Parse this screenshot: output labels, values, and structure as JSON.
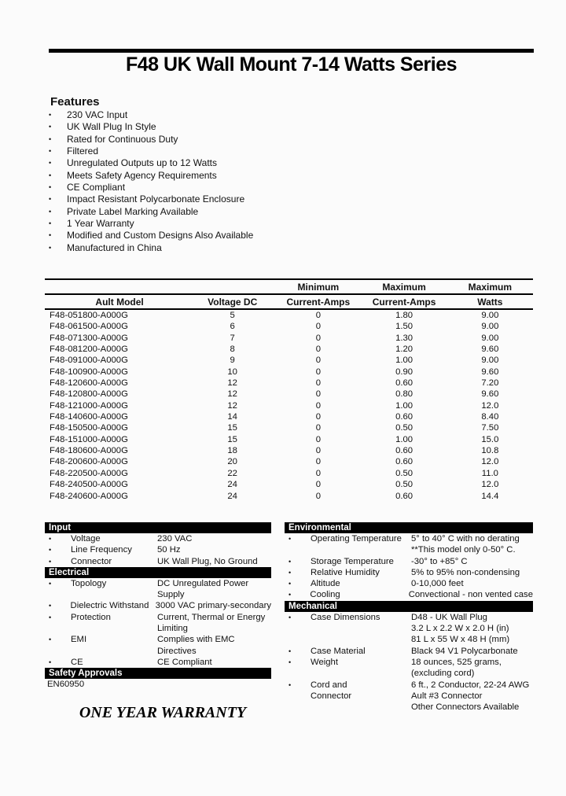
{
  "title": "F48 UK Wall Mount 7-14 Watts Series",
  "features": {
    "heading": "Features",
    "bullet": "•",
    "items": [
      "230 VAC Input",
      "UK Wall Plug In Style",
      "Rated for Continuous Duty",
      "Filtered",
      "Unregulated Outputs up to 12 Watts",
      "Meets Safety Agency Requirements",
      "CE Compliant",
      "Impact Resistant Polycarbonate Enclosure",
      "Private Label Marking Available",
      "1 Year Warranty",
      "Modified and Custom Designs Also Available",
      "Manufactured in China"
    ]
  },
  "models_table": {
    "headers": {
      "model": [
        "",
        "Ault Model"
      ],
      "voltage": [
        "",
        "Voltage DC"
      ],
      "min_current": [
        "Minimum",
        "Current-Amps"
      ],
      "max_current": [
        "Maximum",
        "Current-Amps"
      ],
      "max_watts": [
        "Maximum",
        "Watts"
      ]
    },
    "rows": [
      [
        "F48-051800-A000G",
        "5",
        "0",
        "1.80",
        "9.00"
      ],
      [
        "F48-061500-A000G",
        "6",
        "0",
        "1.50",
        "9.00"
      ],
      [
        "F48-071300-A000G",
        "7",
        "0",
        "1.30",
        "9.00"
      ],
      [
        "F48-081200-A000G",
        "8",
        "0",
        "1.20",
        "9.60"
      ],
      [
        "F48-091000-A000G",
        "9",
        "0",
        "1.00",
        "9.00"
      ],
      [
        "F48-100900-A000G",
        "10",
        "0",
        "0.90",
        "9.60"
      ],
      [
        "F48-120600-A000G",
        "12",
        "0",
        "0.60",
        "7.20"
      ],
      [
        "F48-120800-A000G",
        "12",
        "0",
        "0.80",
        "9.60"
      ],
      [
        "F48-121000-A000G",
        "12",
        "0",
        "1.00",
        "12.0"
      ],
      [
        "F48-140600-A000G",
        "14",
        "0",
        "0.60",
        "8.40"
      ],
      [
        "F48-150500-A000G",
        "15",
        "0",
        "0.50",
        "7.50"
      ],
      [
        "F48-151000-A000G",
        "15",
        "0",
        "1.00",
        "15.0"
      ],
      [
        "F48-180600-A000G",
        "18",
        "0",
        "0.60",
        "10.8"
      ],
      [
        "F48-200600-A000G",
        "20",
        "0",
        "0.60",
        "12.0"
      ],
      [
        "F48-220500-A000G",
        "22",
        "0",
        "0.50",
        "11.0"
      ],
      [
        "F48-240500-A000G",
        "24",
        "0",
        "0.50",
        "12.0"
      ],
      [
        "F48-240600-A000G",
        "24",
        "0",
        "0.60",
        "14.4"
      ]
    ]
  },
  "specs": {
    "bullet": "•",
    "input": {
      "header": "Input",
      "rows": [
        {
          "label": "Voltage",
          "value": [
            "230 VAC"
          ]
        },
        {
          "label": "Line Frequency",
          "value": [
            "50 Hz"
          ]
        },
        {
          "label": "Connector",
          "value": [
            "UK Wall Plug, No Ground"
          ]
        }
      ]
    },
    "electrical": {
      "header": "Electrical",
      "rows": [
        {
          "label": "Topology",
          "value": [
            "DC Unregulated Power",
            "Supply"
          ]
        },
        {
          "label": "Dielectric Withstand",
          "value": [
            "3000 VAC primary-secondary"
          ]
        },
        {
          "label": "Protection",
          "value": [
            "Current, Thermal or Energy",
            "Limiting"
          ]
        },
        {
          "label": "EMI",
          "value": [
            "Complies with EMC",
            "Directives"
          ]
        },
        {
          "label": "CE",
          "value": [
            "CE Compliant"
          ]
        }
      ]
    },
    "safety": {
      "header": "Safety Approvals",
      "value": "EN60950"
    },
    "environmental": {
      "header": "Environmental",
      "rows": [
        {
          "label": "Operating Temperature",
          "value": [
            "5° to 40° C with no derating",
            "**This model only 0-50° C."
          ]
        },
        {
          "label": "Storage Temperature",
          "value": [
            "-30° to +85° C"
          ]
        },
        {
          "label": "Relative Humidity",
          "value": [
            "5% to 95% non-condensing"
          ]
        },
        {
          "label": "Altitude",
          "value": [
            "0-10,000 feet"
          ]
        },
        {
          "label": "Cooling",
          "value": [
            "Convectional - non vented case"
          ]
        }
      ]
    },
    "mechanical": {
      "header": "Mechanical",
      "rows": [
        {
          "label": "Case Dimensions",
          "value": [
            "D48 - UK Wall Plug",
            "3.2  L x 2.2 W x 2.0 H (in)",
            "81 L x 55 W x 48 H (mm)"
          ]
        },
        {
          "label": "Case Material",
          "value": [
            "Black 94 V1 Polycarbonate"
          ]
        },
        {
          "label": "Weight",
          "value": [
            "18 ounces, 525 grams,",
            "(excluding cord)"
          ]
        },
        {
          "label": "Cord and Connector",
          "label_lines": [
            "Cord and",
            "Connector"
          ],
          "value": [
            "6 ft., 2 Conductor, 22-24 AWG",
            "Ault #3 Connector",
            "Other Connectors Available"
          ]
        }
      ]
    }
  },
  "warranty_banner": "ONE YEAR WARRANTY"
}
